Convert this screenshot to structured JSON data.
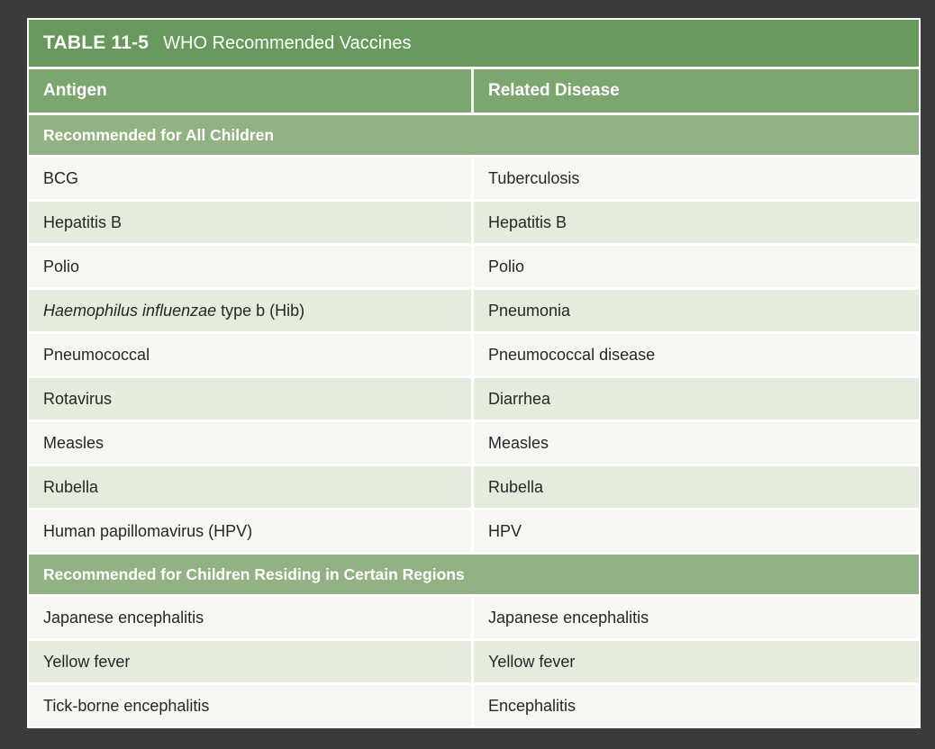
{
  "colors": {
    "bg": "#3b3b3b",
    "title_bar": "#68995c",
    "col_header": "#7ca56f",
    "section_header": "#93b283",
    "row_green": "#e3ecdd",
    "row_white": "#f5f8f2",
    "grid_line": "#ffffff",
    "header_text": "#ffffff",
    "body_text": "#272727"
  },
  "table": {
    "title_label": "TABLE 11-5",
    "title_text": "WHO Recommended Vaccines",
    "columns": [
      "Antigen",
      "Related Disease"
    ],
    "sections": [
      {
        "header": "Recommended for All Children",
        "rows": [
          {
            "antigen": "BCG",
            "disease": "Tuberculosis"
          },
          {
            "antigen": "Hepatitis B",
            "disease": "Hepatitis B"
          },
          {
            "antigen": "Polio",
            "disease": "Polio"
          },
          {
            "antigen_italic": "Haemophilus influenzae",
            "antigen": " type b (Hib)",
            "disease": "Pneumonia"
          },
          {
            "antigen": "Pneumococcal",
            "disease": "Pneumococcal disease"
          },
          {
            "antigen": "Rotavirus",
            "disease": "Diarrhea"
          },
          {
            "antigen": "Measles",
            "disease": "Measles"
          },
          {
            "antigen": "Rubella",
            "disease": "Rubella"
          },
          {
            "antigen": "Human papillomavirus (HPV)",
            "disease": "HPV"
          }
        ]
      },
      {
        "header": "Recommended for Children Residing in Certain Regions",
        "rows": [
          {
            "antigen": "Japanese encephalitis",
            "disease": "Japanese encephalitis"
          },
          {
            "antigen": "Yellow fever",
            "disease": "Yellow fever"
          },
          {
            "antigen": "Tick-borne encephalitis",
            "disease": "Encephalitis"
          }
        ]
      }
    ]
  }
}
